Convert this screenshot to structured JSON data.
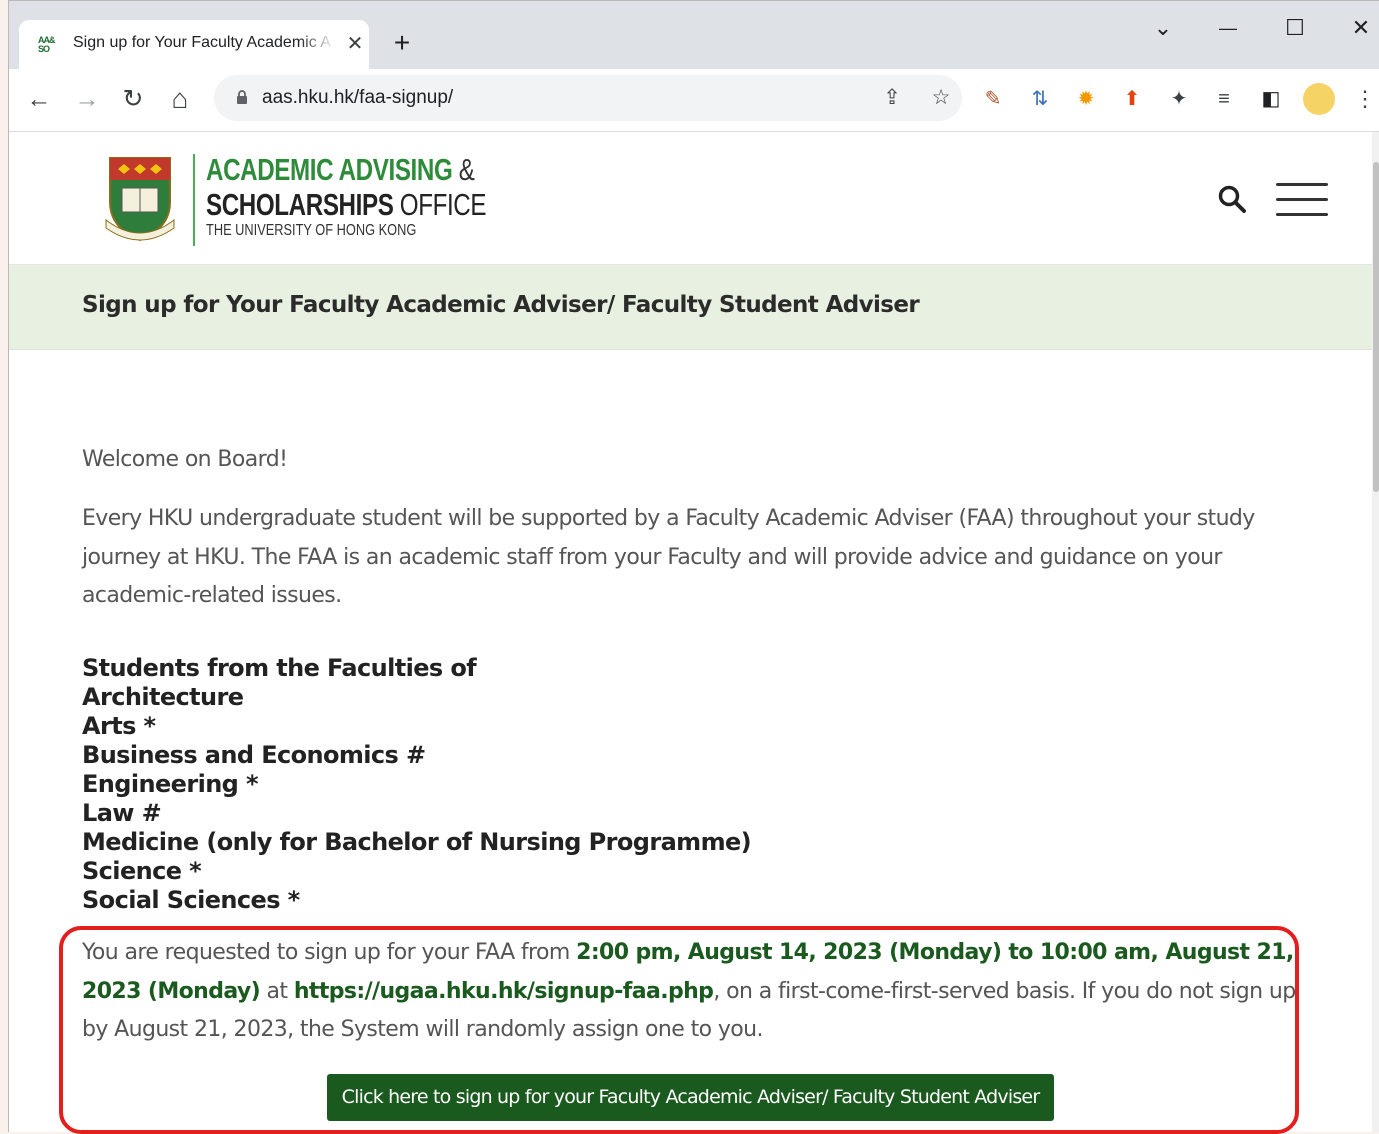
{
  "browser": {
    "tab": {
      "favicon_text": "AA& SO",
      "title": "Sign up for Your Faculty Academic Adviser/ Faculty Student Adviser",
      "close": "✕"
    },
    "new_tab": "+",
    "window_controls": {
      "tabs_search": "⌄",
      "minimize": "—",
      "maximize": "☐",
      "close": "✕"
    },
    "nav": {
      "back": "←",
      "forward": "→",
      "reload": "↻",
      "home": "⌂"
    },
    "url": "aas.hku.hk/faa-signup/",
    "omnibox_icons": {
      "share": "⇪",
      "bookmark": "☆"
    },
    "extensions": [
      "✎",
      "⇅",
      "✹",
      "⬆",
      "✦",
      "≡",
      "◧"
    ],
    "menu": "⋮"
  },
  "site": {
    "logo": {
      "line1": "ACADEMIC ADVISING",
      "line1_amp": "&",
      "line2_bold": "SCHOLARSHIPS",
      "line2_light": "OFFICE",
      "subtitle": "THE UNIVERSITY OF HONG KONG"
    },
    "page_title": "Sign up for Your Faculty Academic Adviser/ Faculty Student Adviser",
    "welcome": "Welcome on Board!",
    "intro": "Every HKU undergraduate student will be supported by a Faculty Academic Adviser (FAA) throughout your study journey at HKU. The FAA is an academic staff from your Faculty and will provide advice and guidance on your academic-related issues.",
    "faculties_heading": "Students from the Faculties of",
    "faculties": [
      "Architecture",
      "Arts *",
      "Business and Economics #",
      "Engineering *",
      "Law #",
      "Medicine (only for Bachelor of Nursing Programme)",
      "Science *",
      "Social Sciences *"
    ],
    "notice": {
      "part1": "You are requested to sign up for your FAA from ",
      "period": "2:00 pm, August 14, 2023 (Monday) to 10:00 am, August 21, 2023 (Monday)",
      "part2": " at ",
      "link": "https://ugaa.hku.hk/signup-faa.php",
      "part3": ", on a first-come-first-served basis. If you do not sign up by August 21, 2023, the System will randomly assign one to you."
    },
    "signup_button": "Click here to sign up for your Faculty Academic Adviser/ Faculty Student Adviser"
  },
  "colors": {
    "brand_green": "#2e8b3a",
    "dark_green": "#1a5a1e",
    "title_band": "#e8f1e1",
    "highlight_red": "#e41d1d"
  }
}
